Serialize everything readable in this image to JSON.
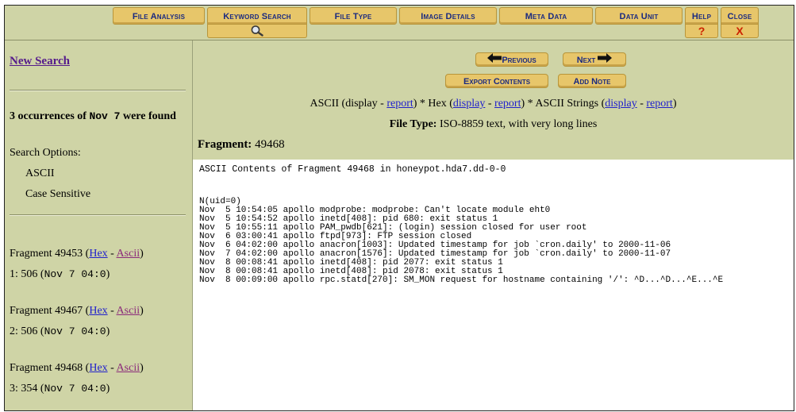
{
  "toolbar": {
    "tabs": [
      {
        "label": "File Analysis"
      },
      {
        "label": "Keyword Search"
      },
      {
        "label": "File Type"
      },
      {
        "label": "Image Details"
      },
      {
        "label": "Meta Data"
      },
      {
        "label": "Data Unit"
      },
      {
        "label": "Help"
      },
      {
        "label": "Close"
      }
    ],
    "help_glyph": "?",
    "close_glyph": "X",
    "search_icon": "magnifier-icon"
  },
  "sidebar": {
    "new_search": "New Search",
    "occurrences_prefix": "3 occurrences of ",
    "occurrences_term": "Nov  7",
    "occurrences_suffix": " were found",
    "options_label": "Search Options:",
    "options": [
      "ASCII",
      "Case Sensitive"
    ],
    "fragments": [
      {
        "prefix": "Fragment 49453 (",
        "hex": "Hex",
        "sep": " - ",
        "ascii": "Ascii",
        "suffix": ")",
        "line2_prefix": "1: 506 (",
        "line2_mono": "Nov  7 04:0",
        "line2_suffix": ")"
      },
      {
        "prefix": "Fragment 49467 (",
        "hex": "Hex",
        "sep": " - ",
        "ascii": "Ascii",
        "suffix": ")",
        "line2_prefix": "2: 506 (",
        "line2_mono": "Nov  7 04:0",
        "line2_suffix": ")"
      },
      {
        "prefix": "Fragment 49468 (",
        "hex": "Hex",
        "sep": " - ",
        "ascii": "Ascii",
        "suffix": ")",
        "line2_prefix": "3: 354 (",
        "line2_mono": "Nov  7 04:0",
        "line2_suffix": ")"
      }
    ]
  },
  "main": {
    "previous_label": "Previous",
    "next_label": "Next",
    "export_label": "Export Contents",
    "add_note_label": "Add Note",
    "views": {
      "ascii_prefix": "ASCII (display - ",
      "ascii_report": "report",
      "sep1": ") * Hex (",
      "hex_display": "display",
      "dash1": " - ",
      "hex_report": "report",
      "sep2": ") * ASCII Strings (",
      "str_display": "display",
      "dash2": " - ",
      "str_report": "report",
      "end": ")"
    },
    "filetype_label": "File Type:",
    "filetype_value": " ISO-8859 text, with very long lines",
    "fragment_label": "Fragment:",
    "fragment_value": " 49468",
    "content_title": "ASCII Contents of Fragment 49468 in honeypot.hda7.dd-0-0",
    "content_lines": [
      "N(uid=0)",
      "Nov  5 10:54:05 apollo modprobe: modprobe: Can't locate module eht0",
      "Nov  5 10:54:52 apollo inetd[408]: pid 680: exit status 1",
      "Nov  5 10:55:11 apollo PAM_pwdb[621]: (login) session closed for user root",
      "Nov  6 03:00:41 apollo ftpd[973]: FTP session closed",
      "Nov  6 04:02:00 apollo anacron[1003]: Updated timestamp for job `cron.daily' to 2000-11-06",
      "Nov  7 04:02:00 apollo anacron[1576]: Updated timestamp for job `cron.daily' to 2000-11-07",
      "Nov  8 00:08:41 apollo inetd[408]: pid 2077: exit status 1",
      "Nov  8 00:08:41 apollo inetd[408]: pid 2078: exit status 1",
      "Nov  8 00:09:00 apollo rpc.statd[270]: SM_MON request for hostname containing '/': ^D...^D...^E...^E"
    ]
  },
  "colors": {
    "panel": "#cfd4a6",
    "tab": "#e7c66a",
    "tab_text": "#1a2a80",
    "close_red": "#cc2200",
    "help_red": "#cc2200"
  }
}
